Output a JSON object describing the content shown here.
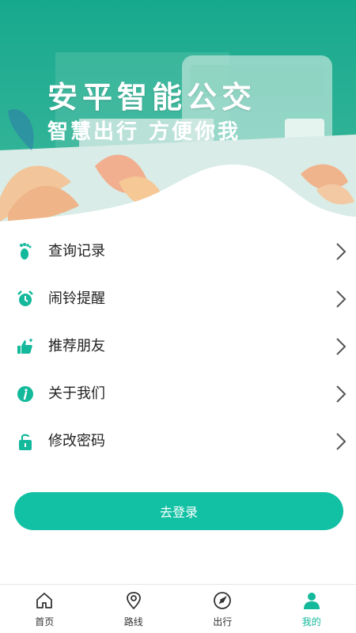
{
  "banner": {
    "title": "安平智能公交",
    "subtitle": "智慧出行 方便你我"
  },
  "menu": {
    "items": [
      {
        "label": "查询记录",
        "icon": "footprint-icon"
      },
      {
        "label": "闹铃提醒",
        "icon": "alarm-clock-icon"
      },
      {
        "label": "推荐朋友",
        "icon": "thumbs-up-icon"
      },
      {
        "label": "关于我们",
        "icon": "info-icon"
      },
      {
        "label": "修改密码",
        "icon": "lock-icon"
      }
    ]
  },
  "login": {
    "label": "去登录"
  },
  "tabbar": {
    "items": [
      {
        "label": "首页",
        "icon": "home-icon",
        "active": false
      },
      {
        "label": "路线",
        "icon": "location-pin-icon",
        "active": false
      },
      {
        "label": "出行",
        "icon": "navigation-icon",
        "active": false
      },
      {
        "label": "我的",
        "icon": "user-icon",
        "active": true
      }
    ]
  },
  "colors": {
    "accent": "#12c1a4",
    "banner": "#1aa98c",
    "text": "#222222"
  }
}
